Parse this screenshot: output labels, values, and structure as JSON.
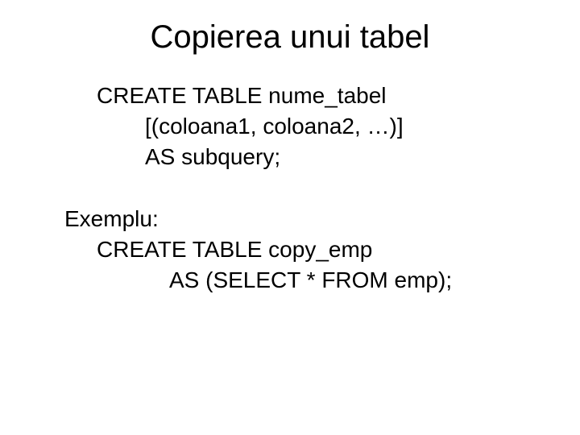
{
  "title": "Copierea unui tabel",
  "syntax": {
    "line1": "CREATE TABLE nume_tabel",
    "line2": "[(coloana1, coloana2, …)]",
    "line3": "AS subquery;"
  },
  "example": {
    "label": "Exemplu:",
    "line1": "CREATE TABLE copy_emp",
    "line2": "AS (SELECT * FROM emp);"
  }
}
